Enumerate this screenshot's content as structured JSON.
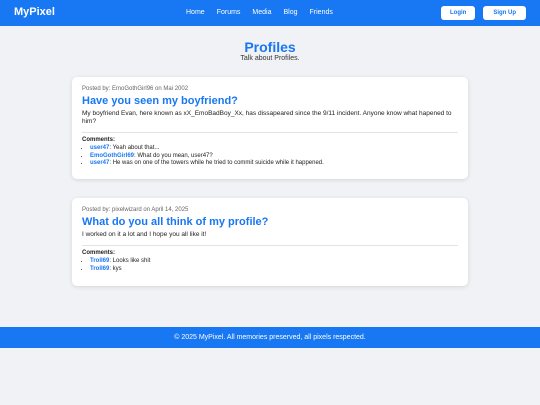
{
  "header": {
    "brand": "MyPixel",
    "nav": [
      "Home",
      "Forums",
      "Media",
      "Blog",
      "Friends"
    ],
    "login_label": "Login",
    "signup_label": "Sign Up"
  },
  "page": {
    "title": "Profiles",
    "subtitle": "Talk about Profiles."
  },
  "posts": [
    {
      "meta": "Posted by: EmoGothGirl96 on Mai 2002",
      "title": "Have you seen my boyfriend?",
      "body": "My boyfriend Evan, here known as xX_EmoBadBoy_Xx, has dissapeared since the 9/11 incident. Anyone know what hapened to him?",
      "comments_label": "Comments:",
      "comments": [
        {
          "user": "user47",
          "text": " Yeah about that..."
        },
        {
          "user": "EmoGothGirl69",
          "text": " What do you mean, user47?"
        },
        {
          "user": "user47",
          "text": " He was on one of the towers while he tried to commit suicide while it happened."
        }
      ]
    },
    {
      "meta": "Posted by: pixelwizard on April 14, 2025",
      "title": "What do you all think of my profile?",
      "body": "I worked on it a lot and I hope you all like it!",
      "comments_label": "Comments:",
      "comments": [
        {
          "user": "Troll69",
          "text": " Looks like shit"
        },
        {
          "user": "Troll69",
          "text": " kys"
        }
      ]
    }
  ],
  "footer": {
    "text": "© 2025 MyPixel. All memories preserved, all pixels respected."
  },
  "colors": {
    "brand": "#1877f2",
    "background": "#f0f2f5"
  }
}
